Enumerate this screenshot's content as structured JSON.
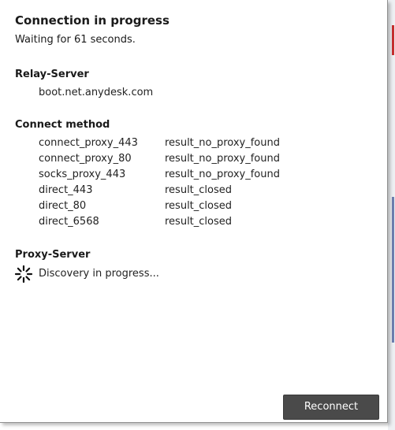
{
  "dialog": {
    "title": "Connection in progress",
    "subtitle": "Waiting for 61 seconds."
  },
  "relay": {
    "heading": "Relay-Server",
    "server": "boot.net.anydesk.com"
  },
  "connect_method": {
    "heading": "Connect method",
    "rows": [
      {
        "method": "connect_proxy_443",
        "result": "result_no_proxy_found"
      },
      {
        "method": "connect_proxy_80",
        "result": "result_no_proxy_found"
      },
      {
        "method": "socks_proxy_443",
        "result": "result_no_proxy_found"
      },
      {
        "method": "direct_443",
        "result": "result_closed"
      },
      {
        "method": "direct_80",
        "result": "result_closed"
      },
      {
        "method": "direct_6568",
        "result": "result_closed"
      }
    ]
  },
  "proxy": {
    "heading": "Proxy-Server",
    "status": "Discovery in progress...",
    "status_icon": "loading-spinner-icon"
  },
  "buttons": {
    "reconnect_label": "Reconnect"
  },
  "colors": {
    "button_bg": "#4a4a4a",
    "button_text": "#ffffff",
    "text": "#1a1a1a",
    "edge_red": "#c62f2f",
    "edge_blue": "#6e7fb0"
  }
}
